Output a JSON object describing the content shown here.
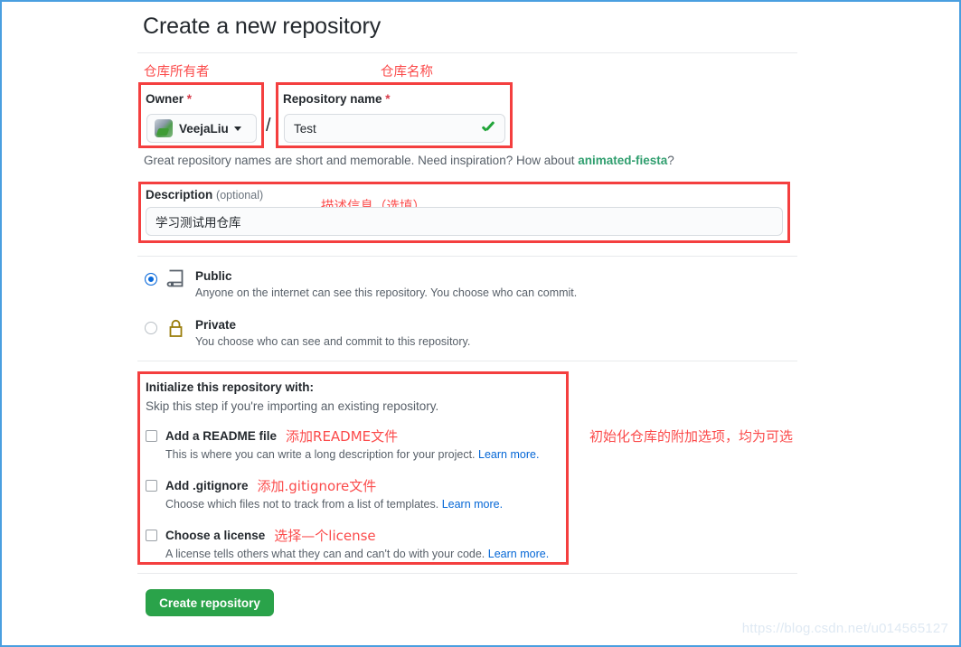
{
  "page": {
    "title": "Create a new repository",
    "watermark": "https://blog.csdn.net/u014565127",
    "accent_green": "#2aa34a",
    "annotation_red": "#fb4b4b",
    "link_blue": "#0366d6",
    "frame_blue": "#4a9fe0"
  },
  "annotations": {
    "owner": "仓库所有者",
    "repo_name": "仓库名称",
    "description": "描述信息（选填）",
    "initialize": "初始化仓库的附加选项，均为可选",
    "readme": "添加README文件",
    "gitignore": "添加.gitignore文件",
    "license": "选择—个license"
  },
  "owner_field": {
    "label": "Owner",
    "required_mark": "*",
    "selected": "VeejaLiu",
    "separator": "/"
  },
  "repo_field": {
    "label": "Repository name",
    "required_mark": "*",
    "value": "Test",
    "valid_icon": "check-icon"
  },
  "hint": {
    "text_before": "Great repository names are short and memorable. Need inspiration? How about ",
    "suggestion": "animated-fiesta",
    "text_after": "?"
  },
  "description_field": {
    "label": "Description",
    "optional": "(optional)",
    "value": "学习测试用仓库"
  },
  "visibility": {
    "options": [
      {
        "id": "public",
        "title": "Public",
        "description": "Anyone on the internet can see this repository. You choose who can commit.",
        "selected": true,
        "icon": "repo-icon"
      },
      {
        "id": "private",
        "title": "Private",
        "description": "You choose who can see and commit to this repository.",
        "selected": false,
        "icon": "lock-icon"
      }
    ]
  },
  "initialize": {
    "title": "Initialize this repository with:",
    "subtitle": "Skip this step if you're importing an existing repository.",
    "items": [
      {
        "label": "Add a README file",
        "description": "This is where you can write a long description for your project.",
        "link": "Learn more.",
        "checked": false
      },
      {
        "label": "Add .gitignore",
        "description": "Choose which files not to track from a list of templates.",
        "link": "Learn more.",
        "checked": false
      },
      {
        "label": "Choose a license",
        "description": "A license tells others what they can and can't do with your code.",
        "link": "Learn more.",
        "checked": false
      }
    ]
  },
  "submit": {
    "label": "Create repository"
  }
}
